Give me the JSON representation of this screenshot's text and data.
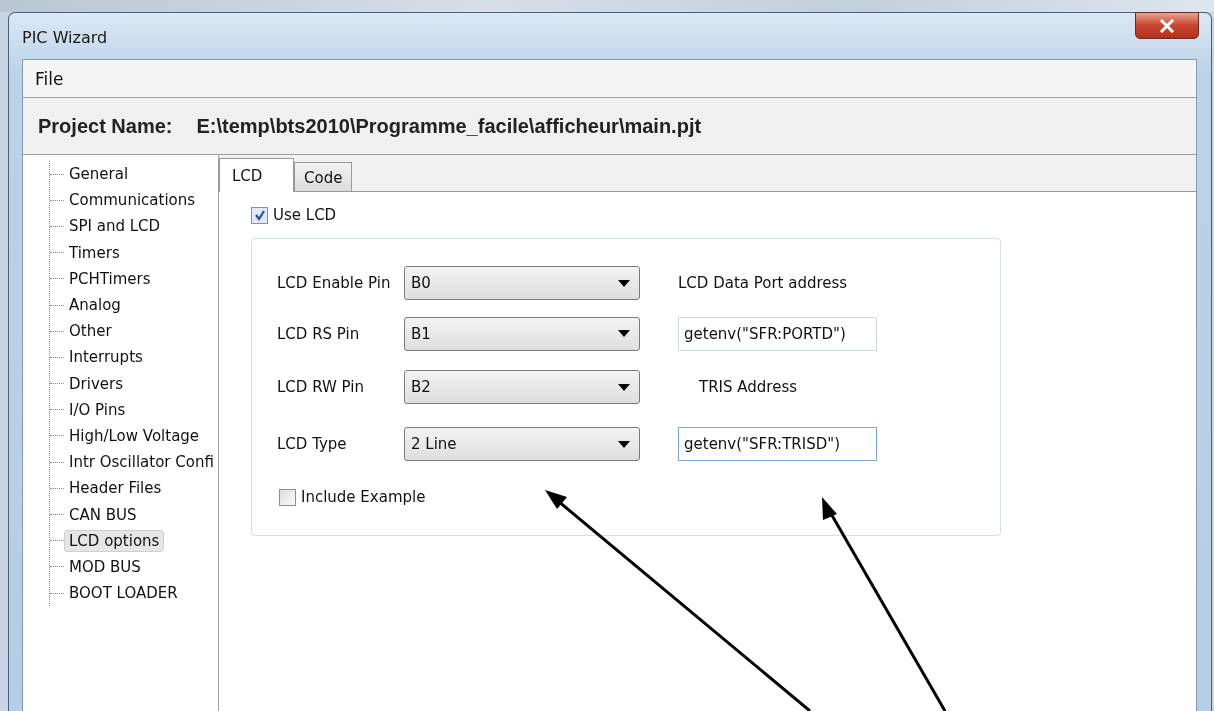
{
  "window": {
    "title": "PIC Wizard"
  },
  "menu": [
    {
      "label": "File"
    }
  ],
  "project": {
    "label": "Project Name:",
    "path": "E:\\temp\\bts2010\\Programme_facile\\afficheur\\main.pjt"
  },
  "tree": [
    {
      "label": "General",
      "selected": false
    },
    {
      "label": "Communications",
      "selected": false
    },
    {
      "label": "SPI and LCD",
      "selected": false
    },
    {
      "label": "Timers",
      "selected": false
    },
    {
      "label": "PCHTimers",
      "selected": false
    },
    {
      "label": "Analog",
      "selected": false
    },
    {
      "label": "Other",
      "selected": false
    },
    {
      "label": "Interrupts",
      "selected": false
    },
    {
      "label": "Drivers",
      "selected": false
    },
    {
      "label": "I/O Pins",
      "selected": false
    },
    {
      "label": "High/Low Voltage",
      "selected": false
    },
    {
      "label": "Intr Oscillator Confi",
      "selected": false
    },
    {
      "label": "Header Files",
      "selected": false
    },
    {
      "label": "CAN BUS",
      "selected": false
    },
    {
      "label": "LCD options",
      "selected": true
    },
    {
      "label": "MOD BUS",
      "selected": false
    },
    {
      "label": "BOOT LOADER",
      "selected": false
    }
  ],
  "tabs": [
    {
      "label": "LCD",
      "selected": true
    },
    {
      "label": "Code",
      "selected": false
    }
  ],
  "use_lcd": {
    "label": "Use LCD",
    "checked": true
  },
  "pins": [
    {
      "label": "LCD Enable Pin",
      "value": "B0"
    },
    {
      "label": "LCD RS Pin",
      "value": "B1"
    },
    {
      "label": "LCD RW Pin",
      "value": "B2"
    },
    {
      "label": "LCD Type",
      "value": "2 Line"
    }
  ],
  "addresses": [
    {
      "label": "LCD Data Port address",
      "value": "getenv(\"SFR:PORTD\")",
      "focused": false
    },
    {
      "label": "TRIS Address",
      "value": "getenv(\"SFR:TRISD\")",
      "focused": true
    }
  ],
  "include_example": {
    "label": "Include Example",
    "checked": false
  }
}
